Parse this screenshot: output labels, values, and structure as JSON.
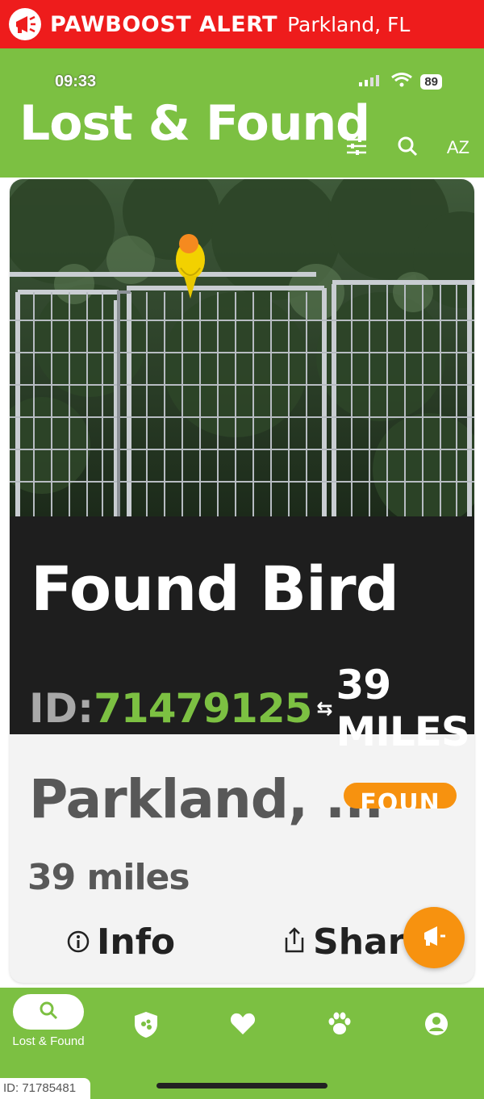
{
  "banner": {
    "brand": "PAWBOOST ALERT",
    "location": "Parkland, FL",
    "icon": "megaphone-icon",
    "color": "#ee1c1c"
  },
  "status_bar": {
    "time": "09:33",
    "battery": "89"
  },
  "header": {
    "title": "Lost & Found",
    "icons": [
      "filter-icon",
      "search-icon",
      "sort-az-icon"
    ],
    "sort_label": "AZ",
    "color": "#7cc042"
  },
  "card": {
    "title": "Found Bird",
    "id_label": "ID:",
    "id_value": "71479125",
    "distance": "39 MILES",
    "location": "Parkland, ...",
    "status_badge": "FOUN",
    "miles": "39 miles",
    "info_label": "Info",
    "share_label": "Share"
  },
  "nav": {
    "items": [
      {
        "label": "Lost & Found",
        "icon": "search-icon",
        "active": true
      },
      {
        "label": "",
        "icon": "shield-pet-icon"
      },
      {
        "label": "",
        "icon": "heart-icon"
      },
      {
        "label": "",
        "icon": "paw-icon"
      },
      {
        "label": "",
        "icon": "profile-icon"
      }
    ]
  },
  "watermark": "ID: 71785481",
  "colors": {
    "accent_green": "#7cc042",
    "accent_orange": "#f7920f",
    "alert_red": "#ee1c1c"
  }
}
